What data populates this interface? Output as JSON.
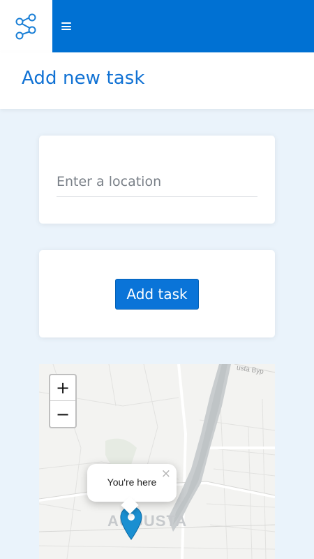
{
  "header": {
    "logo_icon": "share-graph-icon",
    "menu_icon": "hamburger-menu-icon",
    "accent_color": "#0071d3"
  },
  "page": {
    "title": "Add new task"
  },
  "location": {
    "placeholder": "Enter a location",
    "value": ""
  },
  "actions": {
    "add_task_label": "Add task"
  },
  "map": {
    "zoom_in_label": "+",
    "zoom_out_label": "−",
    "popup_text": "You're here",
    "popup_close_label": "×",
    "city_label": "AUGUSTA",
    "road_label": "usta Byp",
    "marker_color": "#1a8fd1"
  }
}
